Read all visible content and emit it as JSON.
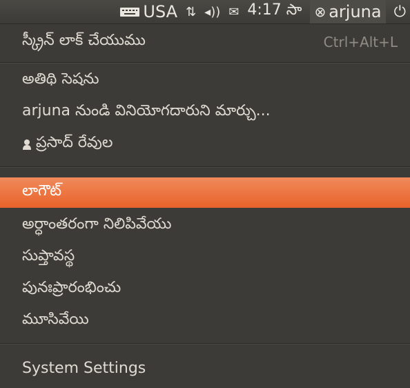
{
  "topbar": {
    "keyboard_layout": "USA",
    "network_icon": "network-updown-icon",
    "volume_icon": "volume-icon",
    "mail_icon": "mail-icon",
    "time": "4:17 సా",
    "user_name": "arjuna",
    "user_status_icon": "user-busy-icon",
    "power_icon": "power-icon"
  },
  "menu": {
    "lock_screen": "స్క్రీన్ లాక్ చేయుము",
    "lock_screen_shortcut": "Ctrl+Alt+L",
    "guest_session": "అతిథి సెషను",
    "switch_user": "arjuna నుండి వినియోగదారుని మార్చు...",
    "other_user": "ప్రసాద్ రేవుల",
    "logout": "లాగౌట్",
    "suspend": "అర్ధాంతరంగా నిలిపివేయు",
    "hibernate": "సుప్తావస్థ",
    "restart": "పునఃప్రారంభించు",
    "shutdown": "మూసివేయి",
    "system_settings": "System Settings"
  },
  "colors": {
    "highlight": "#e9622b",
    "background": "#3c3b37"
  }
}
